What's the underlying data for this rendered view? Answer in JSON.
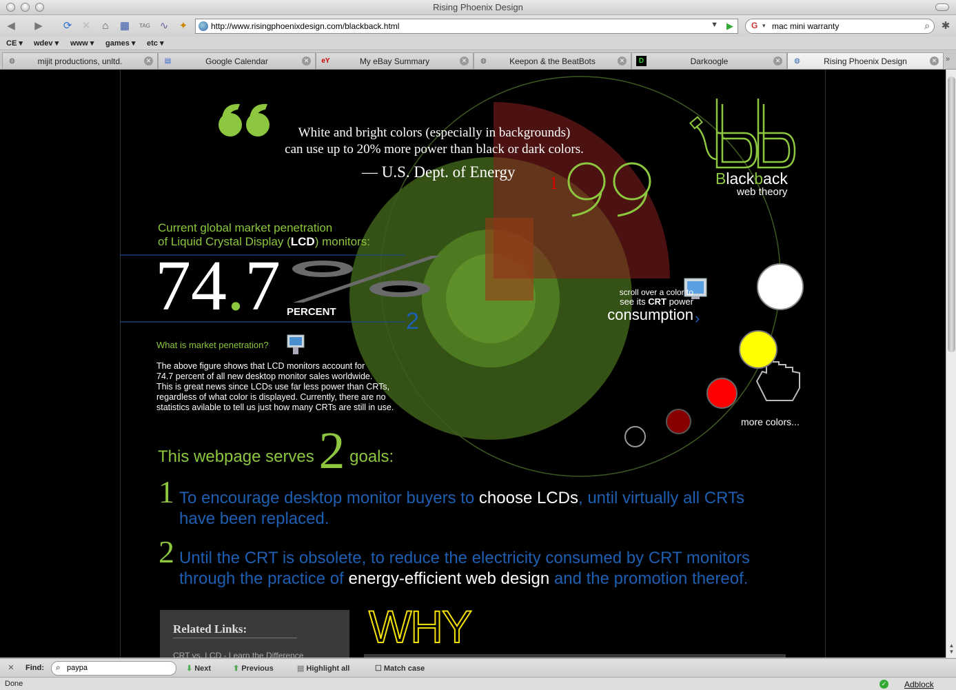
{
  "window": {
    "title": "Rising Phoenix Design"
  },
  "toolbar": {
    "url": "http://www.risingphoenixdesign.com/blackback.html",
    "search_engine": "G",
    "search_query": "mac mini warranty"
  },
  "bookmarks": [
    "CE ▾",
    "wdev ▾",
    "www ▾",
    "games ▾",
    "etc ▾"
  ],
  "tabs": [
    {
      "label": "mijit productions, unltd.",
      "icon": "globe-icon",
      "active": false
    },
    {
      "label": "Google Calendar",
      "icon": "calendar-icon",
      "active": false
    },
    {
      "label": "My eBay Summary",
      "icon": "ebay-icon",
      "active": false
    },
    {
      "label": "Keepon & the BeatBots",
      "icon": "globe-icon",
      "active": false
    },
    {
      "label": "Darkoogle",
      "icon": "darkoogle-icon",
      "active": false
    },
    {
      "label": "Rising Phoenix Design",
      "icon": "globe-icon",
      "active": true
    }
  ],
  "page": {
    "quote_line1": "White and bright colors (especially in backgrounds)",
    "quote_line2": "can use up to 20% more power than black or dark colors.",
    "attribution": "— U.S. Dept. of Energy",
    "ref1": "1",
    "lcd_line1": "Current global market penetration",
    "lcd_line2_pre": "of Liquid Crystal Display (",
    "lcd_line2_bold": "LCD",
    "lcd_line2_post": ") monitors:",
    "big_int": "74",
    "big_dot": ".",
    "big_dec": "7",
    "percent_word": "PERCENT",
    "ref2": "2",
    "mp_question": "What is market penetration?",
    "mp_body_1": "The above figure shows that LCD monitors account for",
    "mp_body_2": "74.7 percent of all new desktop monitor sales worldwide.",
    "mp_body_3": "This is great news since LCDs use far less power than CRTs,",
    "mp_body_4": "regardless of what color is displayed.  Currently, there are no",
    "mp_body_5": "statistics avilable to tell us just how many CRTs are still in use.",
    "hint_l1": "scroll over a color to",
    "hint_l2_pre": "see its ",
    "hint_l2_bold": "CRT",
    "hint_l2_post": " power",
    "hint_l3": "consumption",
    "hint_arrow": "›",
    "logo_letters": "Bb",
    "logo_b1": "B",
    "logo_mid1": "lack",
    "logo_b2": "b",
    "logo_mid2": "ack",
    "logo_sub": "web theory",
    "more_colors": "more colors...",
    "goals_pre": "This webpage serves ",
    "goals_num": "2",
    "goals_post": " goals:",
    "goal1_num": "1",
    "goal1_a": "To encourage desktop monitor buyers to ",
    "goal1_hl": "choose LCDs",
    "goal1_b": ", until virtually all CRTs",
    "goal1_c": "have been replaced.",
    "goal2_num": "2",
    "goal2_a": "Until the CRT is obsolete, to reduce the electricity consumed by CRT monitors",
    "goal2_b": "through the practice of ",
    "goal2_hl": "energy-efficient web design",
    "goal2_c": " and the promotion thereof.",
    "related_title": "Related Links:",
    "related_link1": "CRT vs. LCD - Learn the Difference",
    "why": "WHY"
  },
  "colors": {
    "accent_green": "#8dc63f",
    "accent_blue": "#1e5fb2",
    "swatch_white": "#ffffff",
    "swatch_yellow": "#ffff00",
    "swatch_red": "#ff0000",
    "swatch_darkred": "#880000",
    "swatch_black": "#000000"
  },
  "findbar": {
    "label": "Find:",
    "value": "paypa",
    "next": "Next",
    "previous": "Previous",
    "highlight": "Highlight all",
    "match_case": "Match case"
  },
  "status": {
    "text": "Done",
    "adblock": "Adblock"
  }
}
